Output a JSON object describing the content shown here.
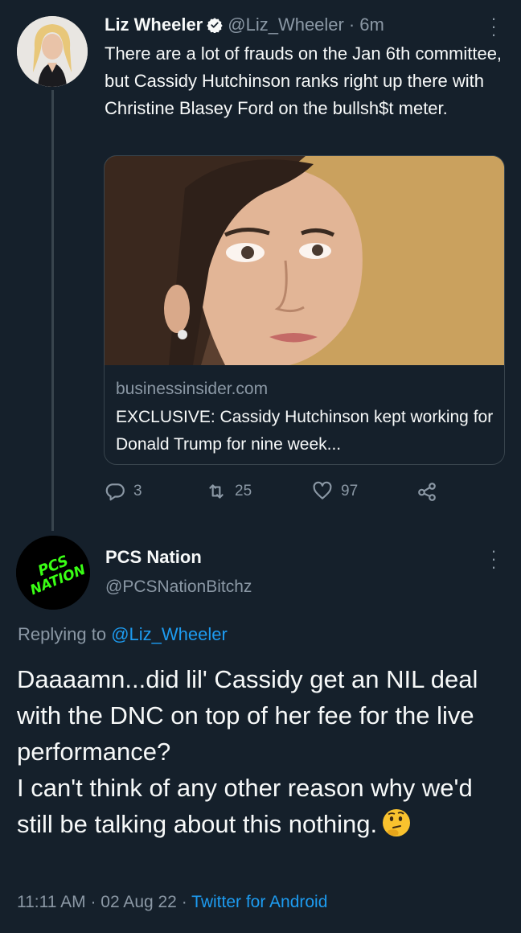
{
  "tweet1": {
    "name": "Liz Wheeler",
    "handle": "@Liz_Wheeler",
    "separator": "·",
    "time": "6m",
    "text": "There are a lot of frauds on the Jan 6th committee, but Cassidy Hutchinson ranks right up there with Christine Blasey Ford on the bullsh$t meter.",
    "card": {
      "domain": "businessinsider.com",
      "title": "EXCLUSIVE: Cassidy Hutchinson kept working for Donald Trump for nine week..."
    },
    "actions": {
      "replies": "3",
      "retweets": "25",
      "likes": "97"
    }
  },
  "tweet2": {
    "name": "PCS Nation",
    "handle": "@PCSNationBitchz",
    "avatar_text": [
      "PCS",
      "NATION"
    ],
    "replying_label": "Replying to",
    "replying_handle": "@Liz_Wheeler",
    "text_lines": [
      "Daaaamn...did lil' Cassidy get an NIL deal with the DNC on top of her fee for the live performance?",
      "I can't think of any other reason why we'd still be talking about this nothing."
    ],
    "emoji": "thinking-face",
    "timestamp": "11:11 AM · 02 Aug 22 · ",
    "source": "Twitter for Android"
  },
  "colors": {
    "background": "#15202b",
    "text": "#f7f9f9",
    "secondary": "#8b98a5",
    "accent": "#1d9bf0",
    "border": "#38444d",
    "avatar_green": "#39ff14"
  }
}
